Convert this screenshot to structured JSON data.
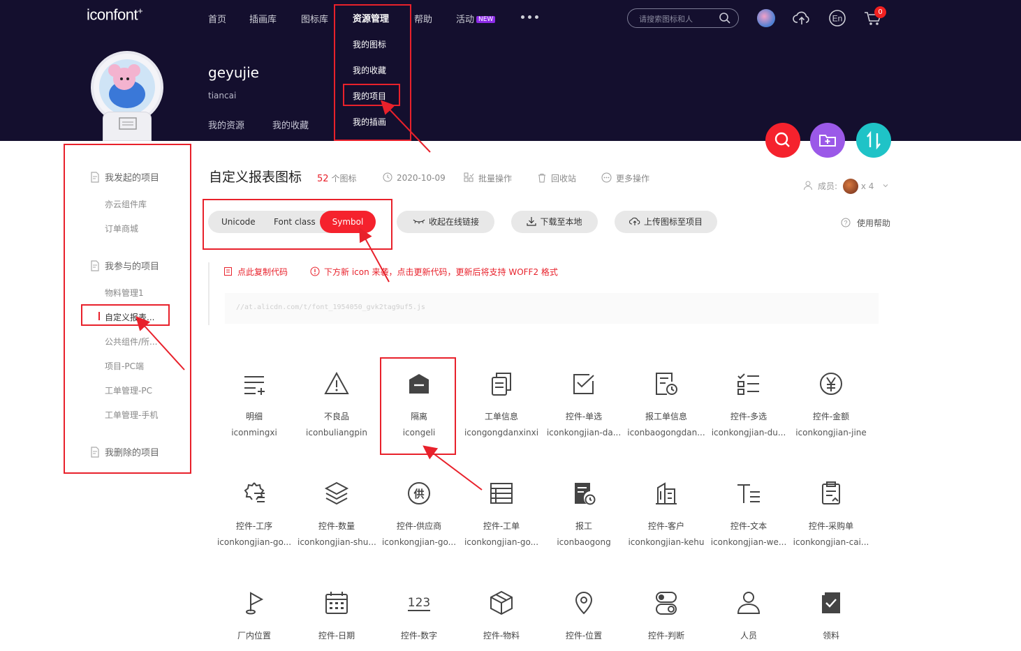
{
  "brand": {
    "logo": "iconfont",
    "logo_mark": "+"
  },
  "nav": {
    "items": [
      "首页",
      "插画库",
      "图标库"
    ],
    "resource": "资源管理",
    "help": "帮助",
    "activity": "活动",
    "new_badge": "NEW",
    "search_placeholder": "请搜索图标和人",
    "cart_count": "0"
  },
  "dropdown": {
    "items": [
      "我的图标",
      "我的收藏",
      "我的项目",
      "我的插画"
    ]
  },
  "profile": {
    "name": "geyujie",
    "subtitle": "tiancai",
    "tabs": [
      "我的资源",
      "我的收藏"
    ]
  },
  "sidebar": {
    "group1": "我发起的项目",
    "group1_items": [
      "亦云组件库",
      "订单商城"
    ],
    "group2": "我参与的项目",
    "group2_items": [
      "物料管理1",
      "自定义报表...",
      "公共组件/所...",
      "项目-PC端",
      "工单管理-PC",
      "工单管理-手机"
    ],
    "group3": "我删除的项目"
  },
  "project": {
    "title": "自定义报表图标",
    "count": "52",
    "count_unit": "个图标",
    "date": "2020-10-09",
    "batch": "批量操作",
    "recycle": "回收站",
    "more": "更多操作",
    "members_label": "成员:",
    "members_count": "x 4"
  },
  "tabs": {
    "unicode": "Unicode",
    "font_class": "Font class",
    "symbol": "Symbol"
  },
  "actions": {
    "collapse": "收起在线链接",
    "download": "下载至本地",
    "upload": "上传图标至项目",
    "help": "使用帮助"
  },
  "notice": {
    "copy": "点此复制代码",
    "warning": "下方新 icon 来袭，点击更新代码，更新后将支持 WOFF2 格式"
  },
  "code_url": "//at.alicdn.com/t/font_1954050_gvk2tag9uf5.js",
  "colors": {
    "header_bg": "#140f2e",
    "accent": "#f5222d",
    "fab_search": "#f5222d",
    "fab_add": "#9b59e8",
    "fab_sort": "#1fc3c7",
    "annotation": "#e8212b"
  },
  "icons": [
    {
      "name": "明细",
      "code": "iconmingxi",
      "icon": "list-plus-icon"
    },
    {
      "name": "不良品",
      "code": "iconbuliangpin",
      "icon": "warning-triangle-icon"
    },
    {
      "name": "隔离",
      "code": "icongeli",
      "icon": "isolation-icon"
    },
    {
      "name": "工单信息",
      "code": "icongongdanxinxi",
      "icon": "copy-doc-icon"
    },
    {
      "name": "控件-单选",
      "code": "iconkongjian-da...",
      "icon": "check-square-icon"
    },
    {
      "name": "报工单信息",
      "code": "iconbaogongdan...",
      "icon": "doc-clock-icon"
    },
    {
      "name": "控件-多选",
      "code": "iconkongjian-du...",
      "icon": "multi-check-icon"
    },
    {
      "name": "控件-金额",
      "code": "iconkongjian-jine",
      "icon": "yen-circle-icon"
    },
    {
      "name": "控件-工序",
      "code": "iconkongjian-go...",
      "icon": "gear-list-icon"
    },
    {
      "name": "控件-数量",
      "code": "iconkongjian-shu...",
      "icon": "layers-icon"
    },
    {
      "name": "控件-供应商",
      "code": "iconkongjian-go...",
      "icon": "supplier-circle-icon"
    },
    {
      "name": "控件-工单",
      "code": "iconkongjian-go...",
      "icon": "table-icon"
    },
    {
      "name": "报工",
      "code": "iconbaogong",
      "icon": "doc-time-icon"
    },
    {
      "name": "控件-客户",
      "code": "iconkongjian-kehu",
      "icon": "building-icon"
    },
    {
      "name": "控件-文本",
      "code": "iconkongjian-we...",
      "icon": "text-icon"
    },
    {
      "name": "控件-采购单",
      "code": "iconkongjian-cai...",
      "icon": "clipboard-icon"
    },
    {
      "name": "厂内位置",
      "code": "",
      "icon": "flag-icon"
    },
    {
      "name": "控件-日期",
      "code": "",
      "icon": "calendar-icon"
    },
    {
      "name": "控件-数字",
      "code": "",
      "icon": "number-icon",
      "glyph": "123"
    },
    {
      "name": "控件-物料",
      "code": "",
      "icon": "box-icon"
    },
    {
      "name": "控件-位置",
      "code": "",
      "icon": "location-pin-icon"
    },
    {
      "name": "控件-判断",
      "code": "",
      "icon": "toggle-icon"
    },
    {
      "name": "人员",
      "code": "",
      "icon": "person-icon"
    },
    {
      "name": "领料",
      "code": "",
      "icon": "check-doc-icon"
    }
  ]
}
